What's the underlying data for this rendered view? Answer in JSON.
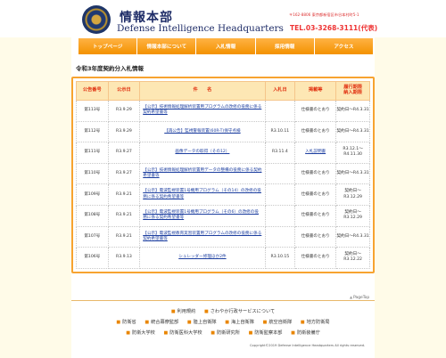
{
  "header": {
    "title_ja": "情報本部",
    "title_en": "Defense Intelligence Headquarters",
    "address": "〒162-8806 東京都新宿区市谷本村町5-1",
    "tel": "TEL.03-3268-3111(代表)"
  },
  "nav": [
    {
      "label": "トップページ"
    },
    {
      "label": "情報本部について"
    },
    {
      "label": "入札情報"
    },
    {
      "label": "採用情報"
    },
    {
      "label": "アクセス"
    }
  ],
  "section_title": "令和3年度契約分入札情報",
  "table": {
    "headers": [
      "公告番号",
      "公示日",
      "件　　名",
      "入札日",
      "掲載等",
      "履行期限\n納入期限"
    ],
    "rows": [
      {
        "no": "第113号",
        "date": "R3.9.29",
        "subject": "【公示】技術情報処理解析装置用プログラムの改修の役務に係る契約希望書等",
        "bid_date": "",
        "posting": "仕様書のとおり",
        "deadline": "契約日～R4.3.31"
      },
      {
        "no": "第112号",
        "date": "R3.9.29",
        "subject": "【再公告】監視警報装置(60R-T)保守点検",
        "bid_date": "R3.10.11",
        "posting": "仕様書のとおり",
        "deadline": "契約日～R4.3.31"
      },
      {
        "no": "第111号",
        "date": "R3.9.27",
        "subject": "画像データの取得（その12）",
        "bid_date": "R3.11.4",
        "posting": "入札説明書",
        "deadline": "R3.12.1～R4.11.30"
      },
      {
        "no": "第110号",
        "date": "R3.9.27",
        "subject": "【公示】技術情報処理解析装置用データの整備の役務に係る契約希望書等",
        "bid_date": "",
        "posting": "仕様書のとおり",
        "deadline": "契約日～R4.3.31"
      },
      {
        "no": "第109号",
        "date": "R3.9.21",
        "subject": "【公示】電波監視装置1号機用プログラム（その14）の改修の役務に係る契約希望書等",
        "bid_date": "",
        "posting": "仕様書のとおり",
        "deadline": "契約日～R3.12.29"
      },
      {
        "no": "第108号",
        "date": "R3.9.21",
        "subject": "【公示】電波監視装置1号機用プログラム（その6）の改修の役務に係る契約希望書等",
        "bid_date": "",
        "posting": "仕様書のとおり",
        "deadline": "契約日～R3.12.29"
      },
      {
        "no": "第107号",
        "date": "R3.9.21",
        "subject": "【公示】電波監視教育実習装置用プログラムの改修の役務に係る契約希望書等",
        "bid_date": "",
        "posting": "仕様書のとおり",
        "deadline": "契約日～R4.3.31"
      },
      {
        "no": "第106号",
        "date": "R3.9.13",
        "subject": "シュレッダー修理ほか2件",
        "bid_date": "R3.10.15",
        "posting": "仕様書のとおり",
        "deadline": "契約日～R3.12.22"
      }
    ]
  },
  "pagetop": "PageTop",
  "footer": {
    "row1": [
      "利用規約",
      "さわやか行政サービスについて"
    ],
    "row2": [
      "防衛省",
      "統合幕僚監部",
      "陸上自衛隊",
      "海上自衛隊",
      "航空自衛隊",
      "地方防衛局"
    ],
    "row3": [
      "防衛大学校",
      "防衛医科大学校",
      "防衛研究所",
      "防衛監察本部",
      "防衛装備庁"
    ],
    "copyright": "Copyright©2019 Defense Intelligence Headquarters All rights reserved."
  }
}
